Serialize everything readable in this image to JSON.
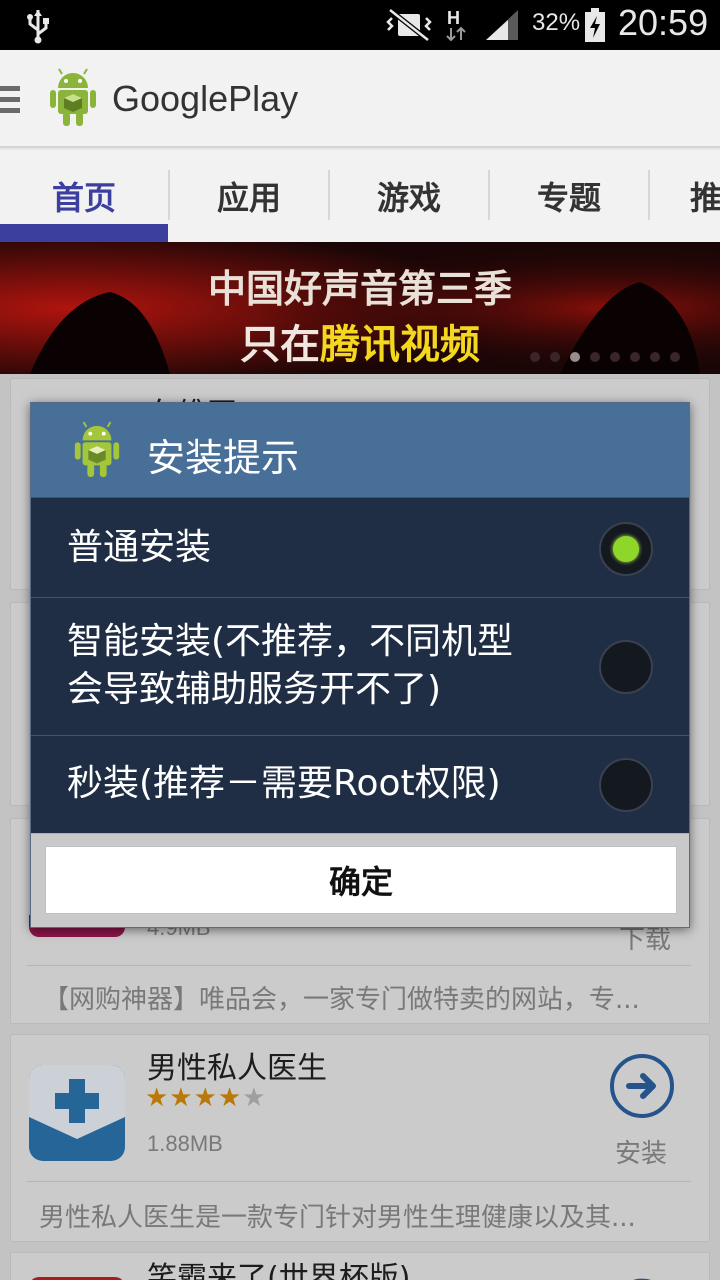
{
  "status_bar": {
    "battery_percent": "32%",
    "time": "20:59",
    "icons": [
      "usb-icon",
      "vibrate-mute-icon",
      "h-data-icon",
      "signal-icon",
      "battery-charging-icon"
    ]
  },
  "app_bar": {
    "title": "GooglePlay",
    "icons": [
      "menu-icon",
      "android-logo-icon"
    ]
  },
  "tabs": [
    {
      "label": "首页",
      "active": true
    },
    {
      "label": "应用",
      "active": false
    },
    {
      "label": "游戏",
      "active": false
    },
    {
      "label": "专题",
      "active": false
    },
    {
      "label": "推",
      "active": false
    }
  ],
  "banner": {
    "line1": "中国好声音第三季",
    "line2_prefix": "只在",
    "line2_highlight": "腾讯视频",
    "carousel_active_index": 2,
    "carousel_count": 8
  },
  "background_list": {
    "partial_title_top": "车维网",
    "card_vip": {
      "size": "4.9MB",
      "action_label": "下载",
      "description": "【网购神器】唯品会，一家专门做特卖的网站，专..."
    },
    "card_doctor": {
      "title": "男性私人医生",
      "rating": 4,
      "rating_max": 5,
      "size": "1.88MB",
      "action_label": "安装",
      "description": "男性私人医生是一款专门针对男性生理健康以及其..."
    },
    "partial_title_bottom": "笑霸来了(世界杯版)"
  },
  "dialog": {
    "title": "安装提示",
    "options": [
      {
        "label": "普通安装",
        "selected": true
      },
      {
        "label_line1": "智能安装(不推荐，不同机型",
        "label_line2": "会导致辅助服务开不了)",
        "selected": false
      },
      {
        "label": "秒装(推荐－需要Root权限)",
        "selected": false
      }
    ],
    "confirm_label": "确定"
  },
  "colors": {
    "accent_tab": "#3d3f9e",
    "dialog_header": "#486f98",
    "dialog_body": "#1f2e44",
    "radio_selected": "#8fd62b",
    "banner_highlight": "#f3d81f"
  }
}
